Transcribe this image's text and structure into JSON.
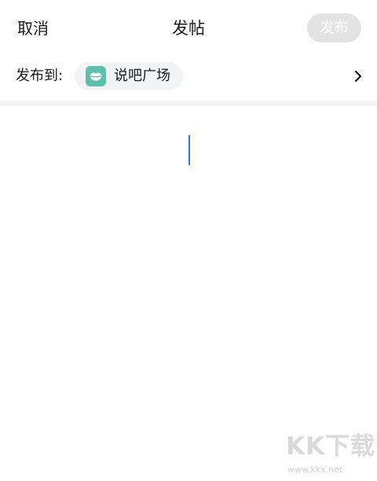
{
  "header": {
    "cancel_label": "取消",
    "title": "发帖",
    "publish_label": "发布"
  },
  "post_target": {
    "label": "发布到:",
    "channel_name": "说吧广场",
    "channel_icon": "lips-icon",
    "chevron_icon": "chevron-right-icon"
  },
  "editor": {
    "content": ""
  },
  "watermark": {
    "logo_text": "KK下载",
    "url": "www.kkx.net"
  },
  "colors": {
    "publish_disabled_bg": "#e3e3e3",
    "channel_icon_bg": "#5fbfad",
    "caret": "#3b6fe0",
    "divider": "#f4f4f6"
  }
}
